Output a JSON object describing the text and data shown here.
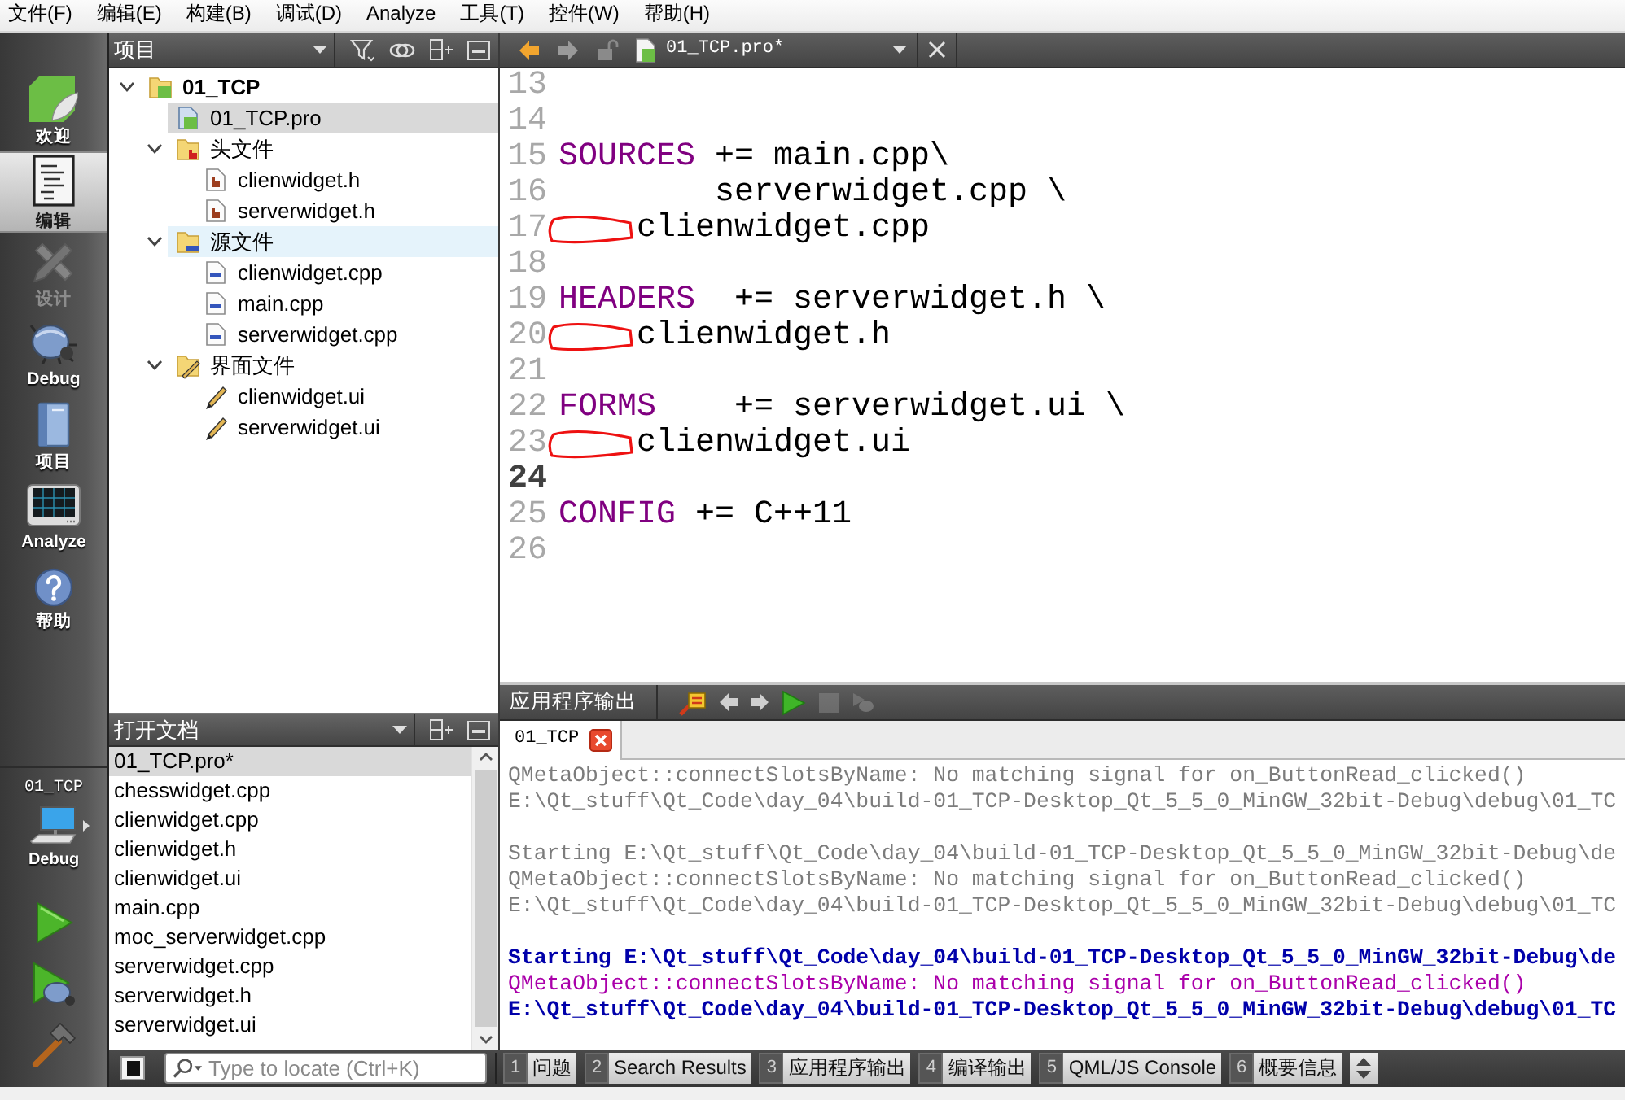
{
  "menu": [
    "文件(F)",
    "编辑(E)",
    "构建(B)",
    "调试(D)",
    "Analyze",
    "工具(T)",
    "控件(W)",
    "帮助(H)"
  ],
  "modes": [
    {
      "label": "欢迎",
      "kind": "welcome",
      "selected": false,
      "disabled": false
    },
    {
      "label": "编辑",
      "kind": "edit",
      "selected": true,
      "disabled": false
    },
    {
      "label": "设计",
      "kind": "design",
      "selected": false,
      "disabled": true
    },
    {
      "label": "Debug",
      "kind": "debug",
      "selected": false,
      "disabled": false
    },
    {
      "label": "项目",
      "kind": "projects",
      "selected": false,
      "disabled": false
    },
    {
      "label": "Analyze",
      "kind": "analyze",
      "selected": false,
      "disabled": false
    },
    {
      "label": "帮助",
      "kind": "help",
      "selected": false,
      "disabled": false
    }
  ],
  "run_target": {
    "project": "01_TCP",
    "config": "Debug"
  },
  "project_pane": {
    "title": "项目",
    "tree": [
      {
        "label": "01_TCP",
        "kind": "project",
        "expanded": true,
        "selected": false,
        "hovered": false,
        "children": [
          {
            "label": "01_TCP.pro",
            "kind": "pro",
            "selected": true,
            "hovered": false
          },
          {
            "label": "头文件",
            "kind": "headers",
            "expanded": true,
            "selected": false,
            "hovered": false,
            "children": [
              {
                "label": "clienwidget.h",
                "kind": "header",
                "selected": false,
                "hovered": false
              },
              {
                "label": "serverwidget.h",
                "kind": "header",
                "selected": false,
                "hovered": false
              }
            ]
          },
          {
            "label": "源文件",
            "kind": "sources",
            "expanded": true,
            "selected": false,
            "hovered": true,
            "children": [
              {
                "label": "clienwidget.cpp",
                "kind": "cpp",
                "selected": false,
                "hovered": false
              },
              {
                "label": "main.cpp",
                "kind": "cpp",
                "selected": false,
                "hovered": false
              },
              {
                "label": "serverwidget.cpp",
                "kind": "cpp",
                "selected": false,
                "hovered": false
              }
            ]
          },
          {
            "label": "界面文件",
            "kind": "forms",
            "expanded": true,
            "selected": false,
            "hovered": false,
            "children": [
              {
                "label": "clienwidget.ui",
                "kind": "ui",
                "selected": false,
                "hovered": false
              },
              {
                "label": "serverwidget.ui",
                "kind": "ui",
                "selected": false,
                "hovered": false
              }
            ]
          }
        ]
      }
    ]
  },
  "open_documents": {
    "title": "打开文档",
    "items": [
      {
        "label": "01_TCP.pro*",
        "selected": true
      },
      {
        "label": "chesswidget.cpp",
        "selected": false
      },
      {
        "label": "clienwidget.cpp",
        "selected": false
      },
      {
        "label": "clienwidget.h",
        "selected": false
      },
      {
        "label": "clienwidget.ui",
        "selected": false
      },
      {
        "label": "main.cpp",
        "selected": false
      },
      {
        "label": "moc_serverwidget.cpp",
        "selected": false
      },
      {
        "label": "serverwidget.cpp",
        "selected": false
      },
      {
        "label": "serverwidget.h",
        "selected": false
      },
      {
        "label": "serverwidget.ui",
        "selected": false
      }
    ]
  },
  "editor": {
    "back": {
      "disabled": false
    },
    "forward": {
      "disabled": true
    },
    "file": "01_TCP.pro*",
    "lines": [
      {
        "number": "13",
        "current": false,
        "marked": false
      },
      {
        "number": "14",
        "current": false,
        "marked": false
      },
      {
        "number": "15",
        "keyword": "SOURCES",
        "text": " += main.cpp\\",
        "current": false,
        "marked": false
      },
      {
        "number": "16",
        "text": "        serverwidget.cpp \\",
        "current": false,
        "marked": false
      },
      {
        "number": "17",
        "text": "    clienwidget.cpp",
        "current": false,
        "marked": true
      },
      {
        "number": "18",
        "current": false,
        "marked": false
      },
      {
        "number": "19",
        "keyword": "HEADERS",
        "text": "  += serverwidget.h \\",
        "current": false,
        "marked": false
      },
      {
        "number": "20",
        "text": "    clienwidget.h",
        "current": false,
        "marked": true
      },
      {
        "number": "21",
        "current": false,
        "marked": false
      },
      {
        "number": "22",
        "keyword": "FORMS",
        "text": "    += serverwidget.ui \\",
        "current": false,
        "marked": false
      },
      {
        "number": "23",
        "text": "    clienwidget.ui",
        "current": false,
        "marked": true
      },
      {
        "number": "24",
        "current": true,
        "marked": false
      },
      {
        "number": "25",
        "keyword": "CONFIG",
        "text": " += C++11",
        "current": false,
        "marked": false
      },
      {
        "number": "26",
        "current": false,
        "marked": false
      }
    ]
  },
  "output": {
    "title": "应用程序输出",
    "tools": [
      {
        "kind": "clear",
        "disabled": false
      },
      {
        "kind": "previous",
        "disabled": false
      },
      {
        "kind": "next",
        "disabled": false
      },
      {
        "kind": "rerun",
        "disabled": false
      },
      {
        "kind": "stop",
        "disabled": true
      },
      {
        "kind": "attach",
        "disabled": true
      }
    ],
    "tabs": [
      {
        "label": "01_TCP",
        "selected": true
      }
    ],
    "lines": [
      {
        "kind": "faded",
        "text": "QMetaObject::connectSlotsByName: No matching signal for on_ButtonRead_clicked()"
      },
      {
        "kind": "faded",
        "text": "E:\\Qt_stuff\\Qt_Code\\day_04\\build-01_TCP-Desktop_Qt_5_5_0_MinGW_32bit-Debug\\debug\\01_TC"
      },
      {
        "kind": "blank"
      },
      {
        "kind": "faded",
        "text": "Starting E:\\Qt_stuff\\Qt_Code\\day_04\\build-01_TCP-Desktop_Qt_5_5_0_MinGW_32bit-Debug\\de"
      },
      {
        "kind": "faded",
        "text": "QMetaObject::connectSlotsByName: No matching signal for on_ButtonRead_clicked()"
      },
      {
        "kind": "faded",
        "text": "E:\\Qt_stuff\\Qt_Code\\day_04\\build-01_TCP-Desktop_Qt_5_5_0_MinGW_32bit-Debug\\debug\\01_TC"
      },
      {
        "kind": "blank"
      },
      {
        "kind": "status",
        "text": "Starting E:\\Qt_stuff\\Qt_Code\\day_04\\build-01_TCP-Desktop_Qt_5_5_0_MinGW_32bit-Debug\\de"
      },
      {
        "kind": "debug",
        "text": "QMetaObject::connectSlotsByName: No matching signal for on_ButtonRead_clicked()"
      },
      {
        "kind": "status",
        "text": "E:\\Qt_stuff\\Qt_Code\\day_04\\build-01_TCP-Desktop_Qt_5_5_0_MinGW_32bit-Debug\\debug\\01_TC"
      }
    ]
  },
  "bottom_bar": {
    "locator": {
      "placeholder": "Type to locate (Ctrl+K)"
    },
    "panes": [
      {
        "number": "1",
        "label": "问题"
      },
      {
        "number": "2",
        "label": "Search Results"
      },
      {
        "number": "3",
        "label": "应用程序输出"
      },
      {
        "number": "4",
        "label": "编译输出"
      },
      {
        "number": "5",
        "label": "QML/JS Console"
      },
      {
        "number": "6",
        "label": "概要信息"
      }
    ]
  }
}
